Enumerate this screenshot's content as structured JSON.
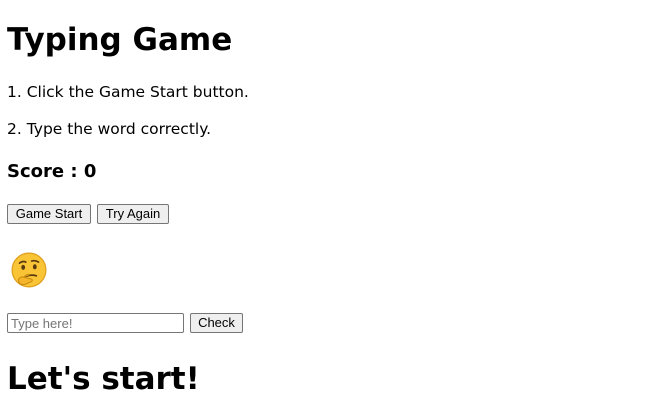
{
  "title": "Typing Game",
  "instructions": [
    "1. Click the Game Start button.",
    "2. Type the word correctly."
  ],
  "score": {
    "label": "Score : 0"
  },
  "buttons": {
    "start_label": "Game Start",
    "again_label": "Try Again",
    "check_label": "Check"
  },
  "status_icon": "thinking-face-icon",
  "input": {
    "value": "",
    "placeholder": "Type here!"
  },
  "message": "Let's start!",
  "colors": {
    "emoji_face": "#f9c536",
    "emoji_outline": "#e0a020",
    "button_bg": "#efefef",
    "border": "#767676"
  }
}
